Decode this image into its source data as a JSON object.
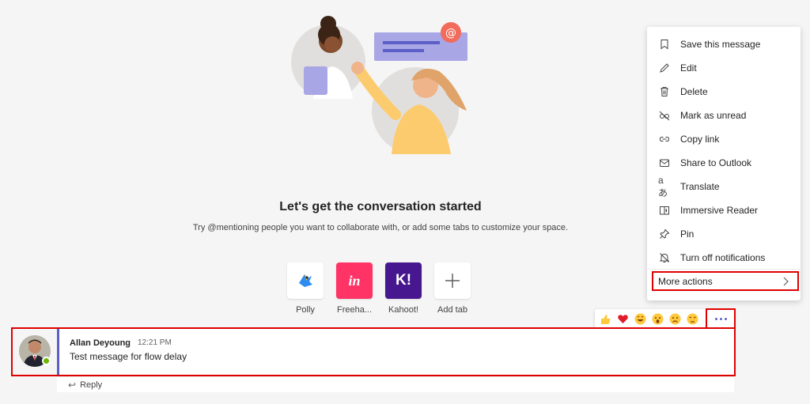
{
  "empty_state": {
    "title": "Let's get the conversation started",
    "subtitle": "Try @mentioning people you want to collaborate with, or add some tabs to customize your space."
  },
  "apps": [
    {
      "label": "Polly",
      "icon": "polly-icon",
      "color": "#ffffff"
    },
    {
      "label": "Freeha...",
      "icon": "freehand-icon",
      "color": "#ff3366"
    },
    {
      "label": "Kahoot!",
      "icon": "kahoot-icon",
      "color": "#46178f"
    },
    {
      "label": "Add tab",
      "icon": "add-icon",
      "color": "#ffffff"
    }
  ],
  "freehand_icon_text": "in",
  "kahoot_icon_text": "K!",
  "reactions": [
    "like",
    "heart",
    "laugh",
    "surprised",
    "sad",
    "angry"
  ],
  "message": {
    "author": "Allan Deyoung",
    "time": "12:21 PM",
    "text": "Test message for flow delay",
    "reply_label": "Reply"
  },
  "menu": {
    "items": [
      {
        "label": "Save this message",
        "icon": "bookmark-icon"
      },
      {
        "label": "Edit",
        "icon": "pencil-icon"
      },
      {
        "label": "Delete",
        "icon": "trash-icon"
      },
      {
        "label": "Mark as unread",
        "icon": "eye-off-icon"
      },
      {
        "label": "Copy link",
        "icon": "link-icon"
      },
      {
        "label": "Share to Outlook",
        "icon": "mail-icon"
      },
      {
        "label": "Translate",
        "icon": "translate-icon"
      },
      {
        "label": "Immersive Reader",
        "icon": "immersive-reader-icon"
      },
      {
        "label": "Pin",
        "icon": "pin-icon"
      },
      {
        "label": "Turn off notifications",
        "icon": "bell-off-icon"
      }
    ],
    "more_actions": "More actions"
  },
  "colors": {
    "accent": "#5b5fc7",
    "highlight": "#e00000",
    "presence": "#6bb700"
  }
}
